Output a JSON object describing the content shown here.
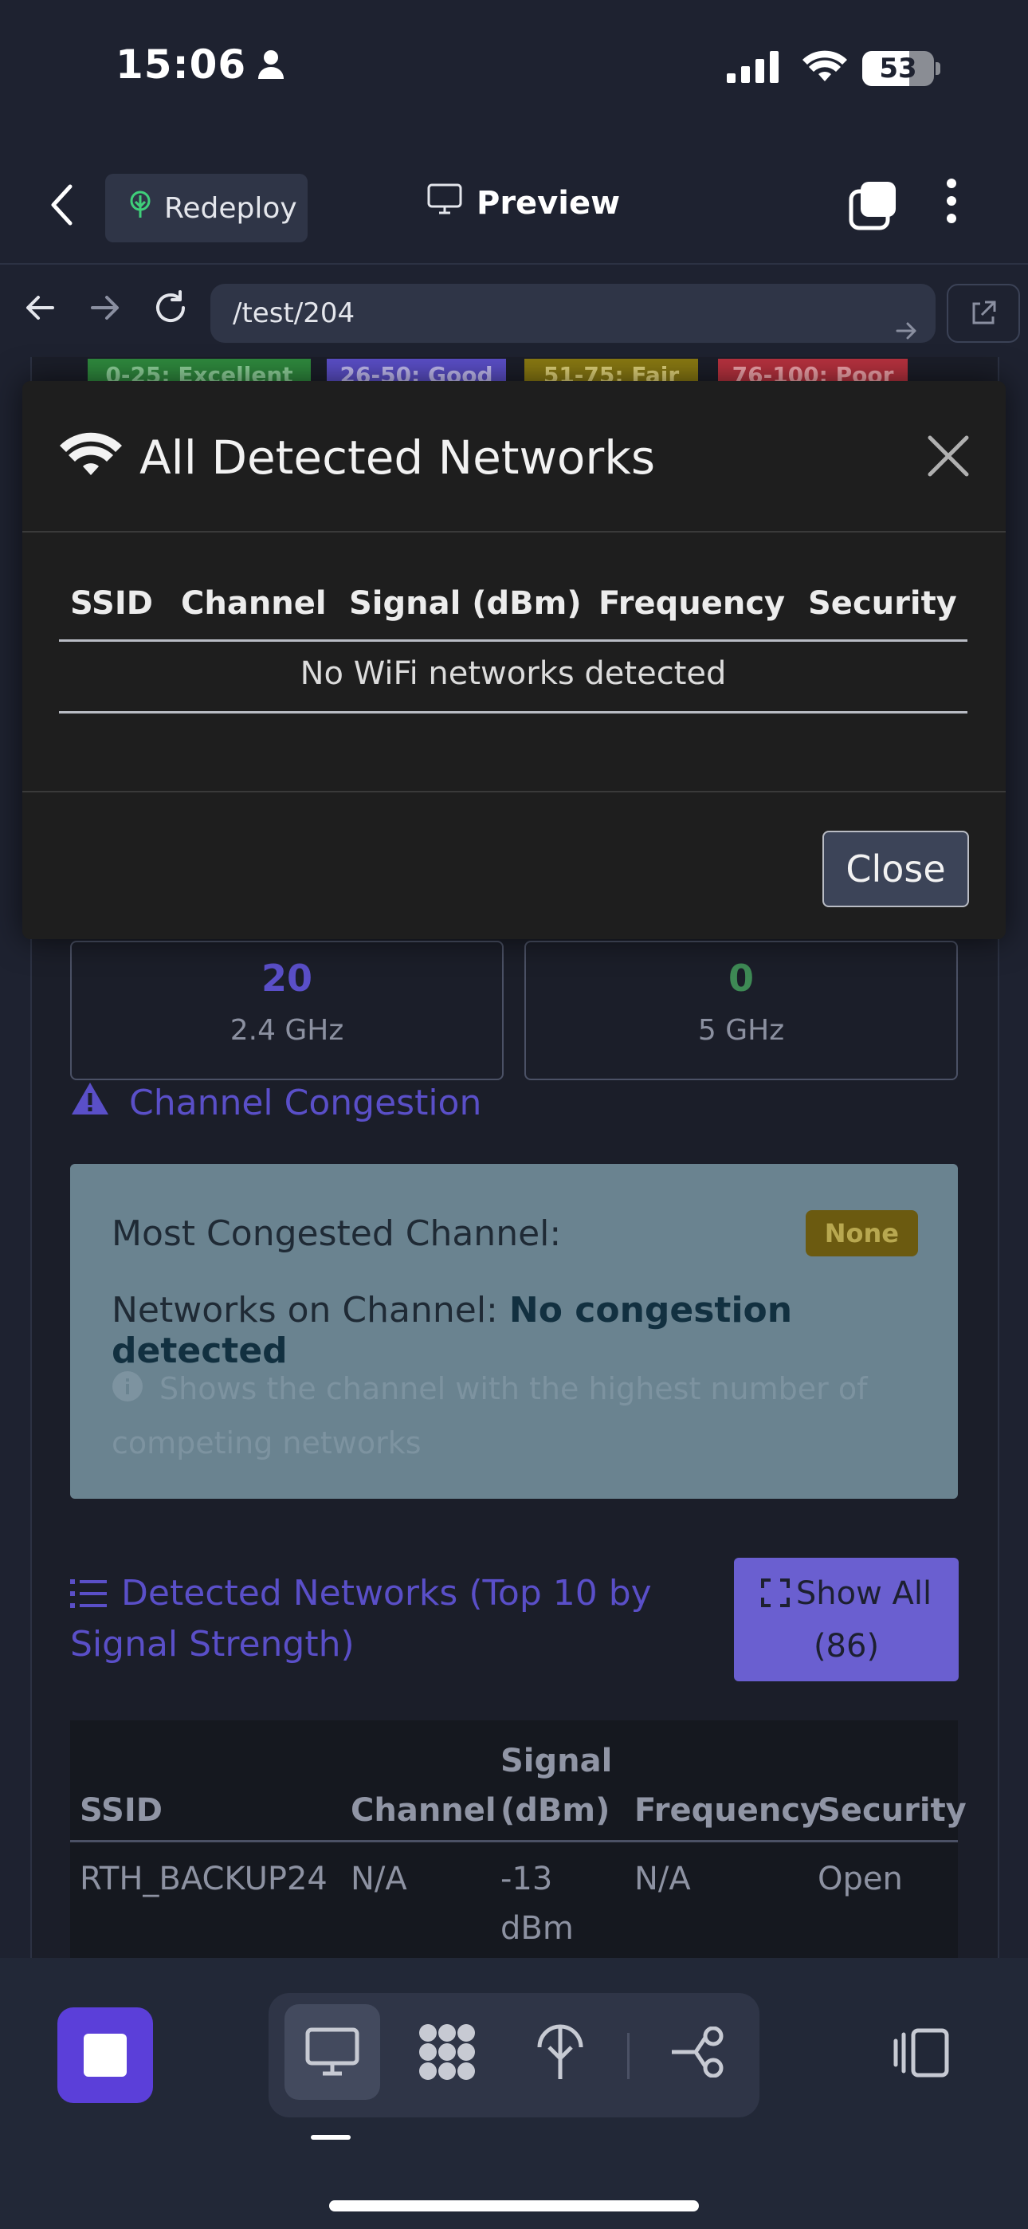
{
  "status_bar": {
    "time": "15:06",
    "battery": "53"
  },
  "header": {
    "redeploy_label": "Redeploy",
    "preview_label": "Preview"
  },
  "browser": {
    "url": "/test/204"
  },
  "legend": [
    {
      "label": "0-25: Excellent",
      "bg": "#2f8a3e",
      "fg": "#8fd19a"
    },
    {
      "label": "26-50: Good",
      "bg": "#5b4fc8",
      "fg": "#c3bdf2"
    },
    {
      "label": "51-75: Fair",
      "bg": "#8a7a12",
      "fg": "#e2d47a"
    },
    {
      "label": "76-100: Poor",
      "bg": "#b8323f",
      "fg": "#f1a4ab"
    }
  ],
  "stats": [
    {
      "value": "20",
      "label": "2.4 GHz",
      "color": "#5a4fc8"
    },
    {
      "value": "0",
      "label": "5 GHz",
      "color": "#3e8a55"
    }
  ],
  "congestion": {
    "title": "Channel Congestion",
    "most_label": "Most Congested Channel:",
    "most_value": "None",
    "networks_label": "Networks on Channel:",
    "networks_value": "No congestion detected",
    "hint": "Shows the channel with the highest number of competing networks"
  },
  "detected": {
    "title": "Detected Networks (Top 10 by Signal Strength)",
    "show_all_label": "Show All",
    "show_all_count": "(86)",
    "columns": {
      "ssid": "SSID",
      "channel": "Channel",
      "signal_a": "Signal",
      "signal_b": "(dBm)",
      "frequency": "Frequency",
      "security": "Security"
    },
    "rows": [
      {
        "ssid": "RTH_BACKUP24",
        "channel": "N/A",
        "signal_a": "-13",
        "signal_b": "dBm",
        "frequency": "N/A",
        "security": "Open"
      }
    ]
  },
  "modal": {
    "title": "All Detected Networks",
    "columns": [
      "SSID",
      "Channel",
      "Signal (dBm)",
      "Frequency",
      "Security"
    ],
    "empty_text": "No WiFi networks detected",
    "close_label": "Close"
  },
  "icons": {
    "wifi": "wifi-icon",
    "close": "close-icon",
    "warning": "warning-triangle-icon",
    "list": "list-icon",
    "expand": "expand-icon",
    "monitor": "monitor-icon"
  }
}
